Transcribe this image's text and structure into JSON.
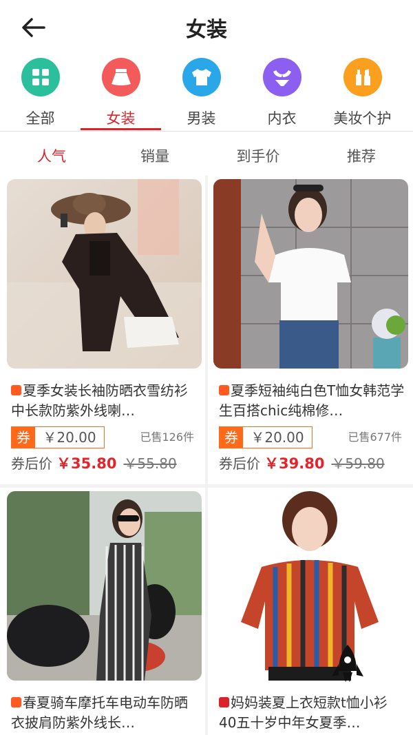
{
  "header": {
    "title": "女装"
  },
  "categories": [
    {
      "label": "全部",
      "icon": "grid-icon",
      "color": "#2bbf9b"
    },
    {
      "label": "女装",
      "icon": "skirt-icon",
      "color": "#f35a5a",
      "active": true
    },
    {
      "label": "男装",
      "icon": "tshirt-icon",
      "color": "#29a7e8"
    },
    {
      "label": "内衣",
      "icon": "bra-icon",
      "color": "#8d5ff0"
    },
    {
      "label": "美妆个护",
      "icon": "cosmetics-icon",
      "color": "#fba01e"
    }
  ],
  "sort_tabs": [
    "人气",
    "销量",
    "到手价",
    "推荐"
  ],
  "products": [
    {
      "title": "夏季女装长袖防晒衣雪纺衫中长款防紫外线喇…",
      "badge": "taobao",
      "coupon_label": "券",
      "coupon_value": "￥20.00",
      "sold": "已售126件",
      "after_label": "券后价",
      "final_price": "￥35.80",
      "original_price": "￥55.80"
    },
    {
      "title": "夏季短袖纯白色T恤女韩范学生百搭chic纯棉修…",
      "badge": "taobao",
      "coupon_label": "券",
      "coupon_value": "￥20.00",
      "sold": "已售677件",
      "after_label": "券后价",
      "final_price": "￥39.80",
      "original_price": "￥59.80"
    },
    {
      "title": "春夏骑车摩托车电动车防晒衣披肩防紫外线长…",
      "badge": "taobao"
    },
    {
      "title": "妈妈装夏上衣短款t恤小衫40五十岁中年女夏季…",
      "badge": "tmall"
    }
  ],
  "colors": {
    "accent": "#d8232a",
    "coupon": "#ff6a1a"
  }
}
